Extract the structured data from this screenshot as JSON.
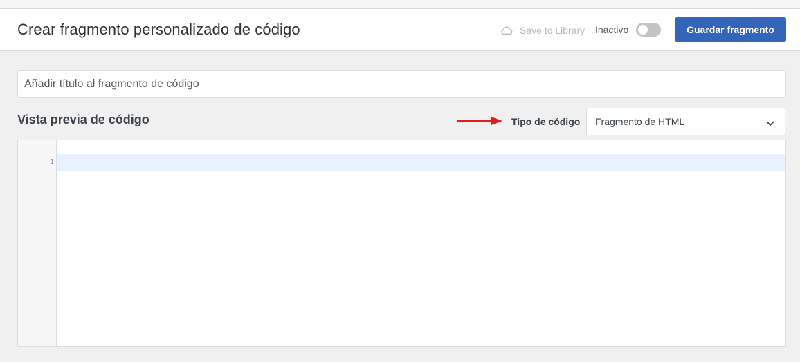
{
  "header": {
    "title": "Crear fragmento personalizado de código",
    "save_to_library": "Save to Library",
    "status_label": "Inactivo",
    "toggle_active": false,
    "save_button": "Guardar fragmento",
    "accent_color": "#3465b8"
  },
  "form": {
    "title_placeholder": "Añadir título al fragmento de código",
    "title_value": ""
  },
  "code_section": {
    "heading": "Vista previa de código",
    "type_label": "Tipo de código",
    "type_selected": "Fragmento de HTML",
    "arrow_color": "#e01e1e"
  },
  "editor": {
    "line_numbers": [
      "1"
    ],
    "content": ""
  },
  "icons": {
    "cloud": "cloud-icon",
    "chevron": "chevron-down-icon",
    "arrow": "arrow-right-icon"
  }
}
